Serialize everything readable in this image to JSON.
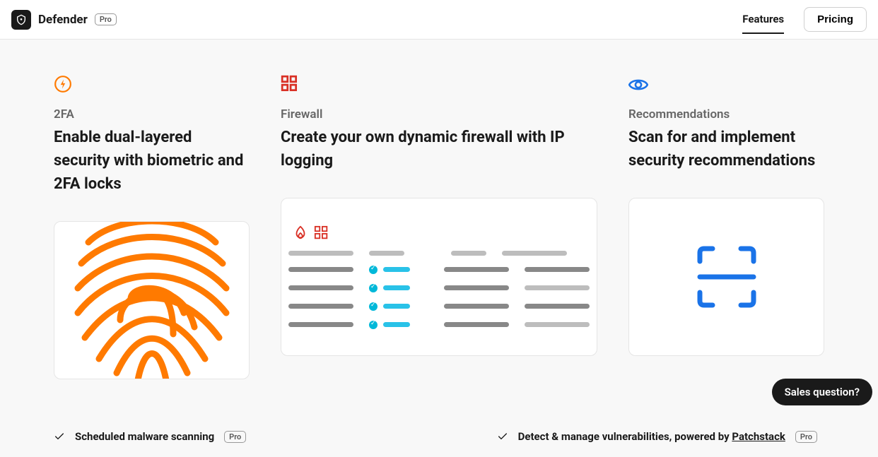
{
  "header": {
    "brand_name": "Defender",
    "pro_badge": "Pro",
    "nav": {
      "features": "Features",
      "pricing": "Pricing"
    }
  },
  "cards": [
    {
      "label": "2FA",
      "title": "Enable dual-layered security with biometric and 2FA locks"
    },
    {
      "label": "Firewall",
      "title": "Create your own dynamic firewall with IP logging"
    },
    {
      "label": "Recommendations",
      "title": "Scan for and implement security recommendations"
    }
  ],
  "features": [
    {
      "text": "Scheduled malware scanning",
      "badge": "Pro"
    },
    {
      "text_prefix": "Detect & manage vulnerabilities, powered by ",
      "text_link": "Patchstack",
      "badge": "Pro"
    }
  ],
  "chat": {
    "label": "Sales question?"
  }
}
